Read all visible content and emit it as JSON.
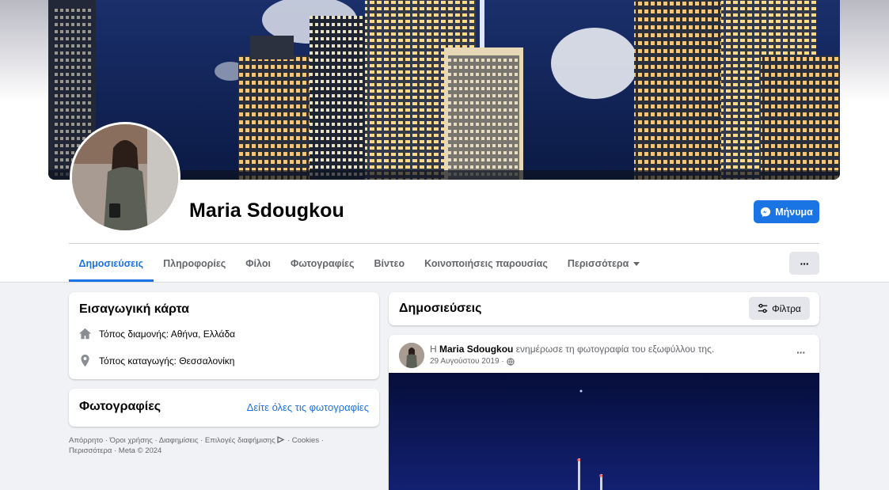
{
  "profile": {
    "name": "Maria Sdougkou"
  },
  "actions": {
    "message_label": "Μήνυμα"
  },
  "tabs": [
    {
      "label": "Δημοσιεύσεις"
    },
    {
      "label": "Πληροφορίες"
    },
    {
      "label": "Φίλοι"
    },
    {
      "label": "Φωτογραφίες"
    },
    {
      "label": "Βίντεο"
    },
    {
      "label": "Κοινοποιήσεις παρουσίας"
    },
    {
      "label": "Περισσότερα"
    }
  ],
  "more_button": "···",
  "intro": {
    "title": "Εισαγωγική κάρτα",
    "residence": {
      "prefix": "Τόπος διαμονής:",
      "value": "Αθήνα, Ελλάδα"
    },
    "origin": {
      "prefix": "Τόπος καταγωγής:",
      "value": "Θεσσαλονίκη"
    }
  },
  "photos": {
    "title": "Φωτογραφίες",
    "link": "Δείτε όλες τις φωτογραφίες"
  },
  "footer": {
    "line1": "Απόρρητο · Όροι χρήσης · Διαφημίσεις · Επιλογές διαφήμισης",
    "line1_tail": " · Cookies ·",
    "line2": "Περισσότερα · Meta © 2024"
  },
  "posts": {
    "title": "Δημοσιεύσεις",
    "filter_label": "Φίλτρα",
    "post": {
      "prefix": "Η",
      "author": "Maria Sdougkou",
      "action": "ενημέρωσε τη φωτογραφία του εξωφύλλου της.",
      "date": "29 Αυγούστου 2019 ·",
      "more": "···"
    }
  },
  "colors": {
    "accent": "#1b74e4",
    "background": "#f0f2f5",
    "card": "#ffffff",
    "secondary_text": "#65676b"
  }
}
